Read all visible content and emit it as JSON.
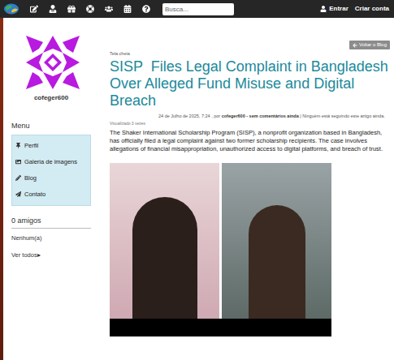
{
  "top_bar": {
    "search": {
      "placeholder": "Busca..."
    },
    "links": [
      "Entrar",
      "Criar conta"
    ]
  },
  "sidebar": {
    "username": "cofeger600",
    "menu_title": "Menu",
    "menu_items": [
      {
        "label": "Perfil",
        "kind": "pin"
      },
      {
        "label": "Galeria de imagens",
        "kind": "image"
      },
      {
        "label": "Blog",
        "kind": "pencil"
      },
      {
        "label": "Contato",
        "kind": "send"
      }
    ],
    "friends_title": "0 amigos",
    "friends_empty": "Nenhum(a)",
    "see_all": "Ver todos",
    "see_all_arrow": "▸"
  },
  "post": {
    "fullscreen": "Tela cheia",
    "back_button": "Voltar o Blog",
    "title": "SISP  Files Legal Complaint in Bangladesh Over Alleged Fund Misuse and Digital Breach",
    "meta": [
      {
        "text": "24 de Julho de 2025, 7:24 , por ",
        "bold": false
      },
      {
        "text": "cofeger600 - sem comentários ainda",
        "bold": true
      },
      {
        "text": " | Ninguém está seguindo este artigo ainda.",
        "bold": false
      }
    ],
    "views": "Visualizado 3 vezes",
    "body": "The Shaker International Scholarship Program (SISP), a nonprofit organization based in Bangladesh, has officially filed a legal complaint against two former scholarship recipients. The case involves allegations of financial misappropriation, unauthorized access to digital platforms, and breach of trust."
  }
}
